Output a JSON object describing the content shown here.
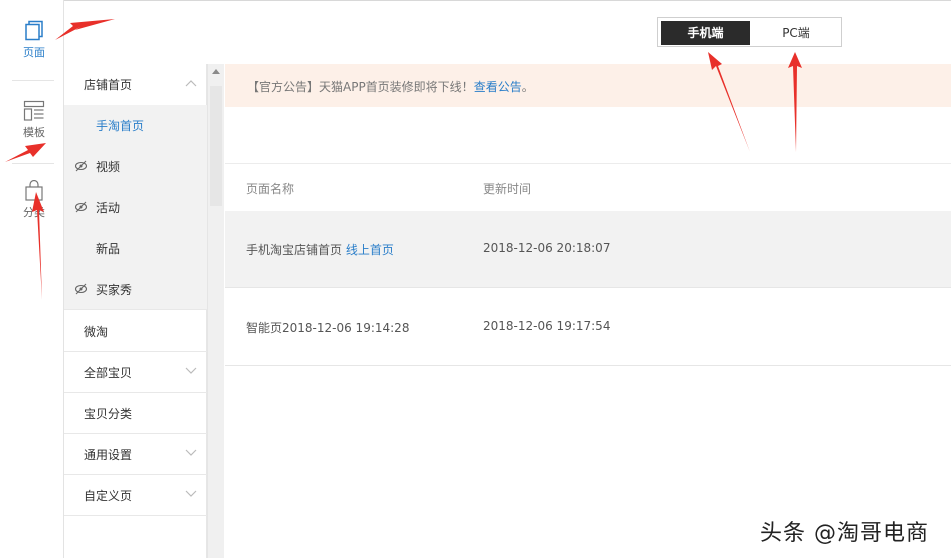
{
  "rail": {
    "items": [
      {
        "label": "页面",
        "icon": "page-icon",
        "active": true
      },
      {
        "label": "模板",
        "icon": "template-icon",
        "active": false
      },
      {
        "label": "分类",
        "icon": "category-bag-icon",
        "active": false
      }
    ]
  },
  "nav": {
    "items": [
      {
        "label": "店铺首页",
        "type": "group",
        "chevron": "up"
      },
      {
        "label": "手淘首页",
        "type": "selected"
      },
      {
        "label": "视频",
        "type": "sub",
        "hidden_icon": true
      },
      {
        "label": "活动",
        "type": "sub",
        "hidden_icon": true
      },
      {
        "label": "新品",
        "type": "sub"
      },
      {
        "label": "买家秀",
        "type": "sub",
        "hidden_icon": true
      },
      {
        "label": "微淘",
        "type": "group"
      },
      {
        "label": "全部宝贝",
        "type": "group",
        "chevron": "down"
      },
      {
        "label": "宝贝分类",
        "type": "group"
      },
      {
        "label": "通用设置",
        "type": "group",
        "chevron": "down"
      },
      {
        "label": "自定义页",
        "type": "group",
        "chevron": "down"
      }
    ]
  },
  "toggle": {
    "mobile_label": "手机端",
    "pc_label": "PC端",
    "selected": "mobile"
  },
  "notice": {
    "text": "【官方公告】天猫APP首页装修即将下线！",
    "link": "查看公告",
    "suffix": "。"
  },
  "table": {
    "headers": [
      "页面名称",
      "更新时间"
    ],
    "rows": [
      {
        "name": "手机淘宝店铺首页",
        "badge": "线上首页",
        "updated": "2018-12-06 20:18:07"
      },
      {
        "name": "智能页2018-12-06 19:14:28",
        "badge": "",
        "updated": "2018-12-06 19:17:54"
      }
    ]
  },
  "watermark": "头条 @淘哥电商",
  "colors": {
    "accent": "#2a7ec9",
    "annotation": "#e8302a",
    "notice_bg": "#fdf0e8"
  }
}
